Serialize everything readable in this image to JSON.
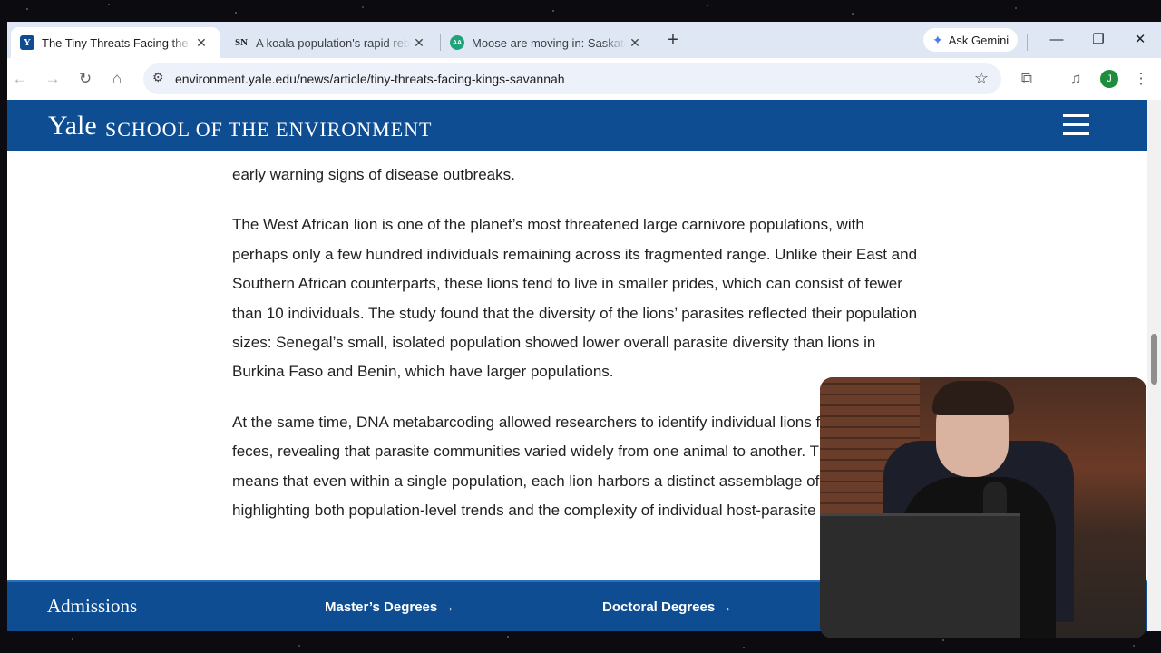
{
  "tabs": [
    {
      "title": "The Tiny Threats Facing the Kings of the Savannah",
      "favicon": "Y"
    },
    {
      "title": "A koala population's rapid rebound",
      "favicon": "SN"
    },
    {
      "title": "Moose are moving in: Saskatoon",
      "favicon": "AA"
    }
  ],
  "new_tab_symbol": "+",
  "gemini_label": "Ask Gemini",
  "address_bar": {
    "url": "environment.yale.edu/news/article/tiny-threats-facing-kings-savannah"
  },
  "profile_initial": "J",
  "site": {
    "logo_main": "Yale",
    "logo_sub": "SCHOOL OF THE ENVIRONMENT"
  },
  "article": {
    "paragraphs": [
      "early warning signs of disease outbreaks.",
      "The West African lion is one of the planet’s most threatened large carnivore populations, with perhaps only a few hundred individuals remaining across its fragmented range. Unlike their East and Southern African counterparts, these lions tend to live in smaller prides, which can consist of fewer than 10 individuals. The study found that the diversity of the lions’ parasites reflected their population sizes: Senegal’s small, isolated population showed lower overall parasite diversity than lions in Burkina Faso and Benin, which have larger populations.",
      "At the same time, DNA metabarcoding allowed researchers to identify individual lions from their feces, revealing that parasite communities varied widely from one animal to another. This diversity means that even within a single population, each lion harbors a distinct assemblage of parasites, highlighting both population-level trends and the complexity of individual host-parasite interactions."
    ]
  },
  "footer": {
    "admissions": "Admissions",
    "masters": "Master’s Degrees",
    "doctoral": "Doctoral Degrees",
    "arrow": "→"
  },
  "colors": {
    "brand_blue": "#0f4d92",
    "tab_strip": "#dfe7f5"
  }
}
